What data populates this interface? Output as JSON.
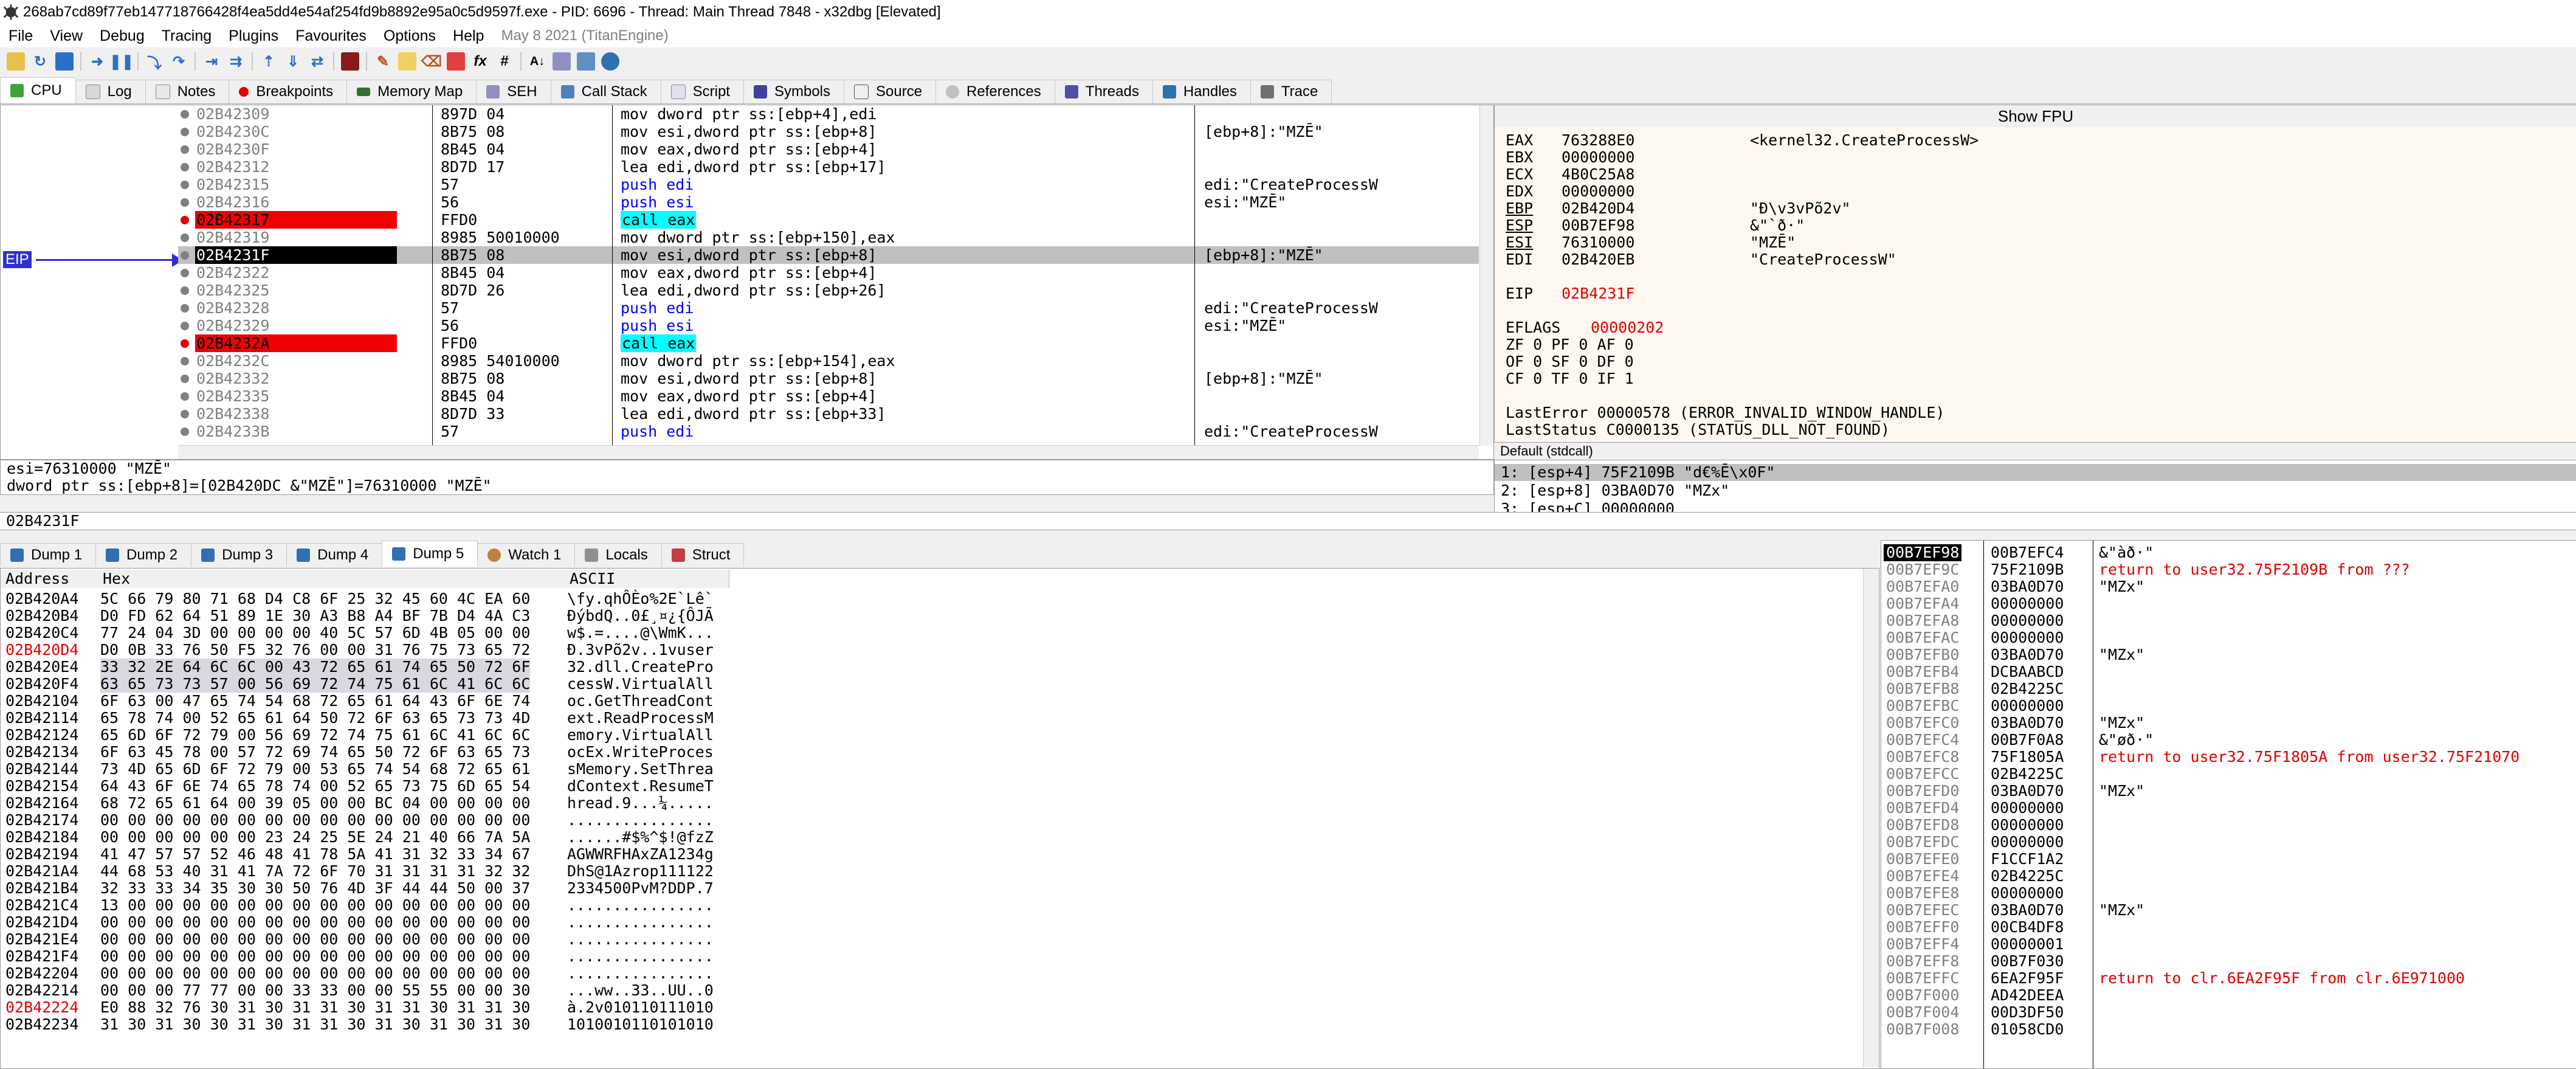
{
  "window": {
    "title": "268ab7cd89f77eb147718766428f4ea5dd4e54af254fd9b8892e95a0c5d9597f.exe - PID: 6696 - Thread: Main Thread 7848 - x32dbg [Elevated]"
  },
  "menu": {
    "items": [
      "File",
      "View",
      "Debug",
      "Tracing",
      "Plugins",
      "Favourites",
      "Options",
      "Help"
    ],
    "date": "May 8 2021 (TitanEngine)"
  },
  "tabs": [
    {
      "label": "CPU",
      "icon": "cpu-icon"
    },
    {
      "label": "Log",
      "icon": "log-icon"
    },
    {
      "label": "Notes",
      "icon": "notes-icon"
    },
    {
      "label": "Breakpoints",
      "icon": "breakpoint-icon"
    },
    {
      "label": "Memory Map",
      "icon": "memory-icon"
    },
    {
      "label": "SEH",
      "icon": "seh-icon"
    },
    {
      "label": "Call Stack",
      "icon": "callstack-icon"
    },
    {
      "label": "Script",
      "icon": "script-icon"
    },
    {
      "label": "Symbols",
      "icon": "symbols-icon"
    },
    {
      "label": "Source",
      "icon": "source-icon"
    },
    {
      "label": "References",
      "icon": "references-icon"
    },
    {
      "label": "Threads",
      "icon": "threads-icon"
    },
    {
      "label": "Handles",
      "icon": "handles-icon"
    },
    {
      "label": "Trace",
      "icon": "trace-icon"
    }
  ],
  "eip_label": "EIP",
  "disasm": [
    {
      "addr": "02B42309",
      "bytes": "897D 04",
      "instr": "mov dword ptr ss:[ebp+4],edi",
      "comment": ""
    },
    {
      "addr": "02B4230C",
      "bytes": "8B75 08",
      "instr": "mov esi,dword ptr ss:[ebp+8]",
      "comment": "[ebp+8]:\"MZĒ\""
    },
    {
      "addr": "02B4230F",
      "bytes": "8B45 04",
      "instr": "mov eax,dword ptr ss:[ebp+4]",
      "comment": ""
    },
    {
      "addr": "02B42312",
      "bytes": "8D7D 17",
      "instr": "lea edi,dword ptr ss:[ebp+17]",
      "comment": ""
    },
    {
      "addr": "02B42315",
      "bytes": "57",
      "instr": "push edi",
      "comment": "edi:\"CreateProcessW"
    },
    {
      "addr": "02B42316",
      "bytes": "56",
      "instr": "push esi",
      "comment": "esi:\"MZĒ\""
    },
    {
      "addr": "02B42317",
      "bytes": "FFD0",
      "instr": "call eax",
      "comment": ""
    },
    {
      "addr": "02B42319",
      "bytes": "8985 50010000",
      "instr": "mov dword ptr ss:[ebp+150],eax",
      "comment": ""
    },
    {
      "addr": "02B4231F",
      "bytes": "8B75 08",
      "instr": "mov esi,dword ptr ss:[ebp+8]",
      "comment": "[ebp+8]:\"MZĒ\""
    },
    {
      "addr": "02B42322",
      "bytes": "8B45 04",
      "instr": "mov eax,dword ptr ss:[ebp+4]",
      "comment": ""
    },
    {
      "addr": "02B42325",
      "bytes": "8D7D 26",
      "instr": "lea edi,dword ptr ss:[ebp+26]",
      "comment": ""
    },
    {
      "addr": "02B42328",
      "bytes": "57",
      "instr": "push edi",
      "comment": "edi:\"CreateProcessW"
    },
    {
      "addr": "02B42329",
      "bytes": "56",
      "instr": "push esi",
      "comment": "esi:\"MZĒ\""
    },
    {
      "addr": "02B4232A",
      "bytes": "FFD0",
      "instr": "call eax",
      "comment": ""
    },
    {
      "addr": "02B4232C",
      "bytes": "8985 54010000",
      "instr": "mov dword ptr ss:[ebp+154],eax",
      "comment": ""
    },
    {
      "addr": "02B42332",
      "bytes": "8B75 08",
      "instr": "mov esi,dword ptr ss:[ebp+8]",
      "comment": "[ebp+8]:\"MZĒ\""
    },
    {
      "addr": "02B42335",
      "bytes": "8B45 04",
      "instr": "mov eax,dword ptr ss:[ebp+4]",
      "comment": ""
    },
    {
      "addr": "02B42338",
      "bytes": "8D7D 33",
      "instr": "lea edi,dword ptr ss:[ebp+33]",
      "comment": ""
    },
    {
      "addr": "02B4233B",
      "bytes": "57",
      "instr": "push edi",
      "comment": "edi:\"CreateProcessW"
    }
  ],
  "breakpoints": [
    "02B42317",
    "02B4232A"
  ],
  "current_eip": "02B4231F",
  "registers": {
    "header": "Show FPU",
    "general": [
      {
        "name": "EAX",
        "value": "763288E0",
        "comment": "<kernel32.CreateProcessW>"
      },
      {
        "name": "EBX",
        "value": "00000000",
        "comment": ""
      },
      {
        "name": "ECX",
        "value": "4B0C25A8",
        "comment": ""
      },
      {
        "name": "EDX",
        "value": "00000000",
        "comment": ""
      },
      {
        "name": "EBP",
        "value": "02B420D4",
        "comment": "\"Ð\\v3vPõ2v\""
      },
      {
        "name": "ESP",
        "value": "00B7EF98",
        "comment": "&\"`ð·\""
      },
      {
        "name": "ESI",
        "value": "76310000",
        "comment": "\"MZĒ\""
      },
      {
        "name": "EDI",
        "value": "02B420EB",
        "comment": "\"CreateProcessW\""
      }
    ],
    "eip": {
      "name": "EIP",
      "value": "02B4231F"
    },
    "eflags": {
      "name": "EFLAGS",
      "value": "00000202"
    },
    "flags": [
      "ZF 0  PF 0  AF 0",
      "OF 0  SF 0  DF 0",
      "CF 0  TF 0  IF 1"
    ],
    "last_error": "LastError  00000578  (ERROR_INVALID_WINDOW_HANDLE)",
    "last_status": "LastStatus C0000135  (STATUS_DLL_NOT_FOUND)"
  },
  "callconv": {
    "header": "Default (stdcall)",
    "rows": [
      "1: [esp+4] 75F2109B \"d€%Ē\\x0F\"",
      "2: [esp+8] 03BA0D70 \"MZx\"",
      "3: [esp+C] 00000000"
    ]
  },
  "info": {
    "line1": "esi=76310000 \"MZĒ\"",
    "line2": "dword ptr ss:[ebp+8]=[02B420DC &\"MZĒ\"]=76310000 \"MZĒ\""
  },
  "address_bar": "02B4231F",
  "dump_tabs": [
    {
      "label": "Dump 1"
    },
    {
      "label": "Dump 2"
    },
    {
      "label": "Dump 3"
    },
    {
      "label": "Dump 4"
    },
    {
      "label": "Dump 5"
    },
    {
      "label": "Watch 1"
    },
    {
      "label": "Locals"
    },
    {
      "label": "Struct"
    }
  ],
  "dump": {
    "headers": {
      "address": "Address",
      "hex": "Hex",
      "ascii": "ASCII"
    },
    "rows": [
      {
        "addr": "02B420A4",
        "hex": "5C 66 79 80 71 68 D4 C8 6F 25 32 45 60 4C EA 60",
        "ascii": "\\fy.qhÔÈo%2E`Lê`"
      },
      {
        "addr": "02B420B4",
        "hex": "D0 FD 62 64 51 89 1E 30 A3 B8 A4 BF 7B D4 4A C3",
        "ascii": "ÐýbdQ..0£¸¤¿{ÔJÃ"
      },
      {
        "addr": "02B420C4",
        "hex": "77 24 04 3D 00 00 00 00 40 5C 57 6D 4B 05 00 00",
        "ascii": "w$.=....@\\WmK..."
      },
      {
        "addr": "02B420D4",
        "hex": "D0 0B 33 76 50 F5 32 76 00 00 31 76 75 73 65 72",
        "ascii": "Ð.3vPõ2v..1vuser"
      },
      {
        "addr": "02B420E4",
        "hex": "33 32 2E 64 6C 6C 00 43 72 65 61 74 65 50 72 6F",
        "ascii": "32.dll.CreatePro"
      },
      {
        "addr": "02B420F4",
        "hex": "63 65 73 73 57 00 56 69 72 74 75 61 6C 41 6C 6C",
        "ascii": "cessW.VirtualAll"
      },
      {
        "addr": "02B42104",
        "hex": "6F 63 00 47 65 74 54 68 72 65 61 64 43 6F 6E 74",
        "ascii": "oc.GetThreadCont"
      },
      {
        "addr": "02B42114",
        "hex": "65 78 74 00 52 65 61 64 50 72 6F 63 65 73 73 4D",
        "ascii": "ext.ReadProcessM"
      },
      {
        "addr": "02B42124",
        "hex": "65 6D 6F 72 79 00 56 69 72 74 75 61 6C 41 6C 6C",
        "ascii": "emory.VirtualAll"
      },
      {
        "addr": "02B42134",
        "hex": "6F 63 45 78 00 57 72 69 74 65 50 72 6F 63 65 73",
        "ascii": "ocEx.WriteProces"
      },
      {
        "addr": "02B42144",
        "hex": "73 4D 65 6D 6F 72 79 00 53 65 74 54 68 72 65 61",
        "ascii": "sMemory.SetThrea"
      },
      {
        "addr": "02B42154",
        "hex": "64 43 6F 6E 74 65 78 74 00 52 65 73 75 6D 65 54",
        "ascii": "dContext.ResumeT"
      },
      {
        "addr": "02B42164",
        "hex": "68 72 65 61 64 00 39 05 00 00 BC 04 00 00 00 00",
        "ascii": "hread.9...¼....."
      },
      {
        "addr": "02B42174",
        "hex": "00 00 00 00 00 00 00 00 00 00 00 00 00 00 00 00",
        "ascii": "................"
      },
      {
        "addr": "02B42184",
        "hex": "00 00 00 00 00 00 23 24 25 5E 24 21 40 66 7A 5A",
        "ascii": "......#$%^$!@fzZ"
      },
      {
        "addr": "02B42194",
        "hex": "41 47 57 57 52 46 48 41 78 5A 41 31 32 33 34 67",
        "ascii": "AGWWRFHAxZA1234g"
      },
      {
        "addr": "02B421A4",
        "hex": "44 68 53 40 31 41 7A 72 6F 70 31 31 31 31 32 32",
        "ascii": "DhS@1Azrop111122"
      },
      {
        "addr": "02B421B4",
        "hex": "32 33 33 34 35 30 30 50 76 4D 3F 44 44 50 00 37",
        "ascii": "2334500PvM?DDP.7"
      },
      {
        "addr": "02B421C4",
        "hex": "13 00 00 00 00 00 00 00 00 00 00 00 00 00 00 00",
        "ascii": "................"
      },
      {
        "addr": "02B421D4",
        "hex": "00 00 00 00 00 00 00 00 00 00 00 00 00 00 00 00",
        "ascii": "................"
      },
      {
        "addr": "02B421E4",
        "hex": "00 00 00 00 00 00 00 00 00 00 00 00 00 00 00 00",
        "ascii": "................"
      },
      {
        "addr": "02B421F4",
        "hex": "00 00 00 00 00 00 00 00 00 00 00 00 00 00 00 00",
        "ascii": "................"
      },
      {
        "addr": "02B42204",
        "hex": "00 00 00 00 00 00 00 00 00 00 00 00 00 00 00 00",
        "ascii": "................"
      },
      {
        "addr": "02B42214",
        "hex": "00 00 00 77 77 00 00 33 33 00 00 55 55 00 00 30",
        "ascii": "...ww..33..UU..0"
      },
      {
        "addr": "02B42224",
        "hex": "E0 88 32 76 30 31 30 31 31 30 31 31 30 31 31 30",
        "ascii": "à.2v010110111010"
      },
      {
        "addr": "02B42234",
        "hex": "31 30 31 30 30 31 30 31 31 30 31 30 31 30 31 30",
        "ascii": "1010010110101010"
      }
    ],
    "red_addr": [
      "02B420D4",
      "02B42224"
    ]
  },
  "stack": {
    "rows": [
      {
        "addr": "00B7EF98",
        "value": "00B7EFC4",
        "comment": "&\"àð·\"",
        "ret": false
      },
      {
        "addr": "00B7EF9C",
        "value": "75F2109B",
        "comment": "return to user32.75F2109B from ???",
        "ret": true
      },
      {
        "addr": "00B7EFA0",
        "value": "03BA0D70",
        "comment": "\"MZx\"",
        "ret": false
      },
      {
        "addr": "00B7EFA4",
        "value": "00000000",
        "comment": "",
        "ret": false
      },
      {
        "addr": "00B7EFA8",
        "value": "00000000",
        "comment": "",
        "ret": false
      },
      {
        "addr": "00B7EFAC",
        "value": "00000000",
        "comment": "",
        "ret": false
      },
      {
        "addr": "00B7EFB0",
        "value": "03BA0D70",
        "comment": "\"MZx\"",
        "ret": false
      },
      {
        "addr": "00B7EFB4",
        "value": "DCBAABCD",
        "comment": "",
        "ret": false
      },
      {
        "addr": "00B7EFB8",
        "value": "02B4225C",
        "comment": "",
        "ret": false
      },
      {
        "addr": "00B7EFBC",
        "value": "00000000",
        "comment": "",
        "ret": false
      },
      {
        "addr": "00B7EFC0",
        "value": "03BA0D70",
        "comment": "\"MZx\"",
        "ret": false
      },
      {
        "addr": "00B7EFC4",
        "value": "00B7F0A8",
        "comment": "&\"øð·\"",
        "ret": false
      },
      {
        "addr": "00B7EFC8",
        "value": "75F1805A",
        "comment": "return to user32.75F1805A from user32.75F21070",
        "ret": true
      },
      {
        "addr": "00B7EFCC",
        "value": "02B4225C",
        "comment": "",
        "ret": false
      },
      {
        "addr": "00B7EFD0",
        "value": "03BA0D70",
        "comment": "\"MZx\"",
        "ret": false
      },
      {
        "addr": "00B7EFD4",
        "value": "00000000",
        "comment": "",
        "ret": false
      },
      {
        "addr": "00B7EFD8",
        "value": "00000000",
        "comment": "",
        "ret": false
      },
      {
        "addr": "00B7EFDC",
        "value": "00000000",
        "comment": "",
        "ret": false
      },
      {
        "addr": "00B7EFE0",
        "value": "F1CCF1A2",
        "comment": "",
        "ret": false
      },
      {
        "addr": "00B7EFE4",
        "value": "02B4225C",
        "comment": "",
        "ret": false
      },
      {
        "addr": "00B7EFE8",
        "value": "00000000",
        "comment": "",
        "ret": false
      },
      {
        "addr": "00B7EFEC",
        "value": "03BA0D70",
        "comment": "\"MZx\"",
        "ret": false
      },
      {
        "addr": "00B7EFF0",
        "value": "00CB4DF8",
        "comment": "",
        "ret": false
      },
      {
        "addr": "00B7EFF4",
        "value": "00000001",
        "comment": "",
        "ret": false
      },
      {
        "addr": "00B7EFF8",
        "value": "00B7F030",
        "comment": "",
        "ret": false
      },
      {
        "addr": "00B7EFFC",
        "value": "6EA2F95F",
        "comment": "return to clr.6EA2F95F from clr.6E971000",
        "ret": true
      },
      {
        "addr": "00B7F000",
        "value": "AD42DEEA",
        "comment": "",
        "ret": false
      },
      {
        "addr": "00B7F004",
        "value": "00D3DF50",
        "comment": "",
        "ret": false
      },
      {
        "addr": "00B7F008",
        "value": "01058CD0",
        "comment": "",
        "ret": false
      }
    ]
  },
  "colors": {
    "accent": "#3030d0",
    "breakpoint": "#f00000",
    "return": "#e00000",
    "highlight": "#00ffff"
  }
}
